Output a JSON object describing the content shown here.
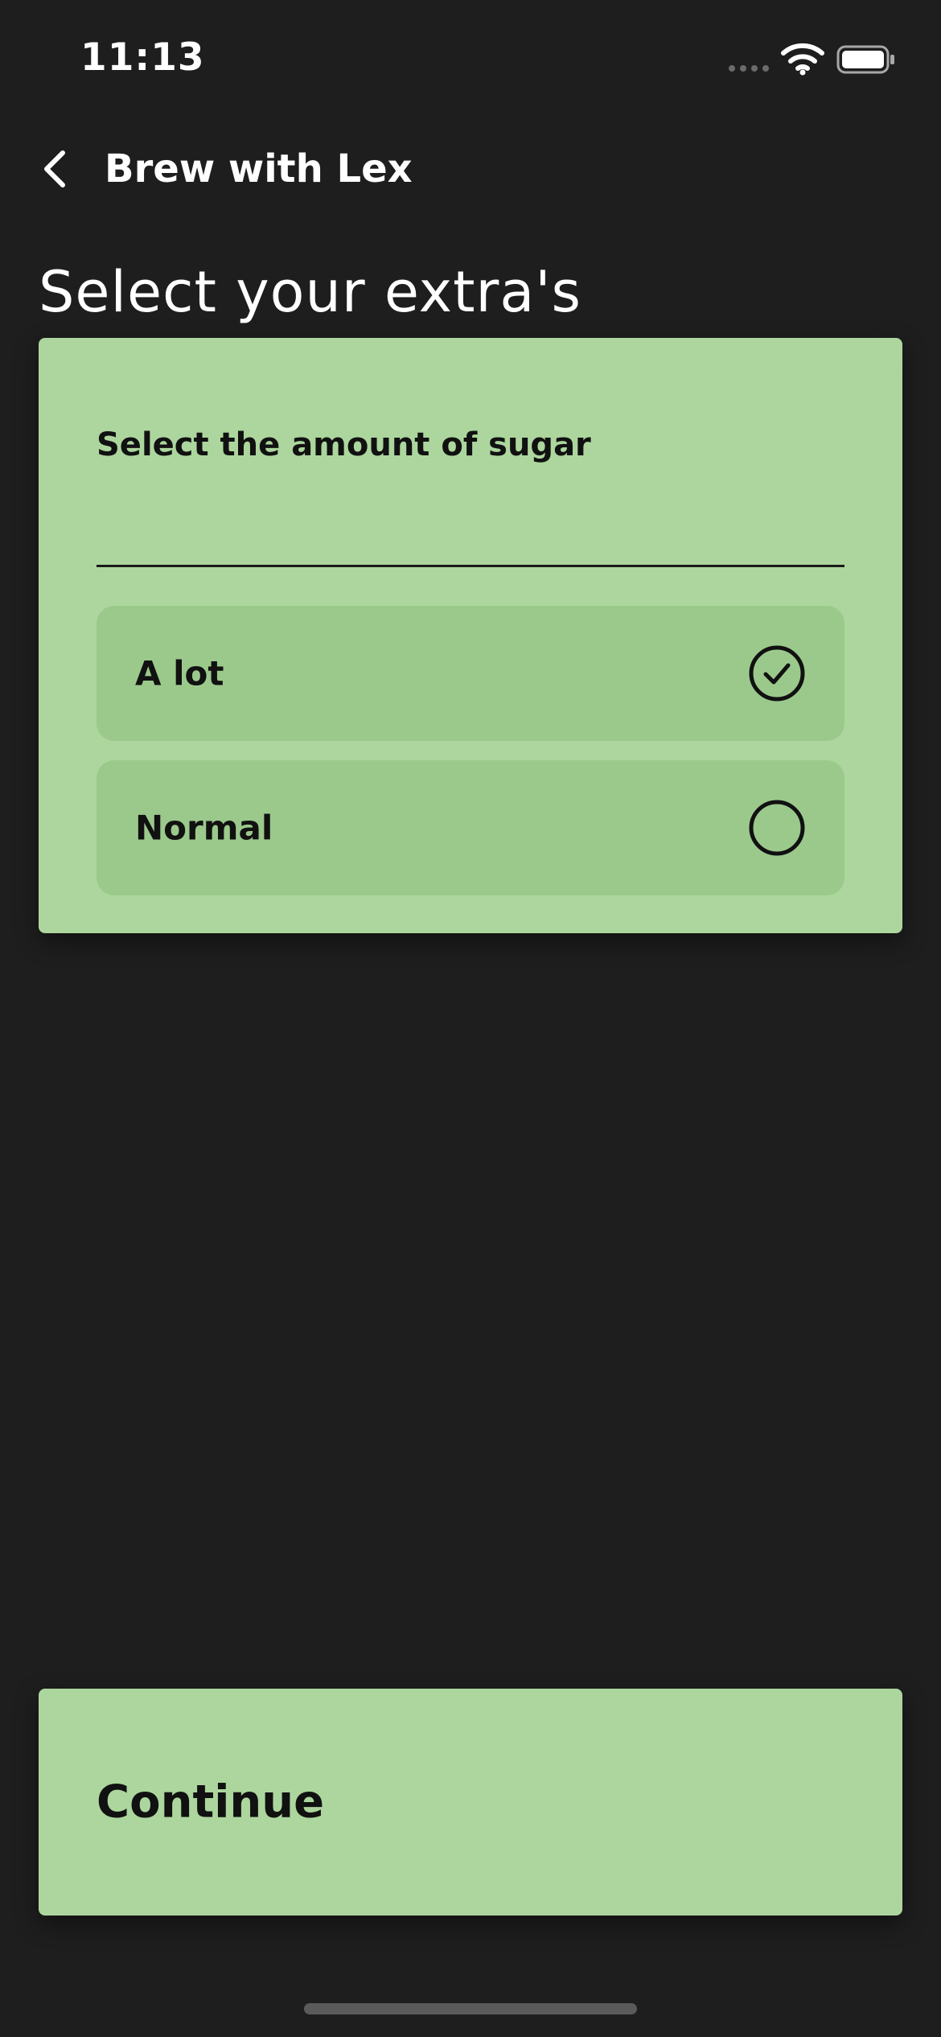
{
  "status_bar": {
    "time": "11:13",
    "icons": [
      "signal-icon",
      "wifi-icon",
      "battery-icon"
    ]
  },
  "nav": {
    "back_icon": "chevron-left-icon",
    "back_label": "Brew with Lex"
  },
  "page": {
    "title": "Select your extra's"
  },
  "sugar_card": {
    "heading": "Select the amount of sugar",
    "options": [
      {
        "label": "A lot",
        "selected": true,
        "icon": "check-circle-icon"
      },
      {
        "label": "Normal",
        "selected": false,
        "icon": "empty-circle-icon"
      }
    ]
  },
  "continue_button": {
    "label": "Continue"
  },
  "colors": {
    "background": "#1e1e1e",
    "card": "#acd69d",
    "option": "#9bc98c",
    "text_dark": "#111111",
    "text_light": "#ffffff"
  }
}
